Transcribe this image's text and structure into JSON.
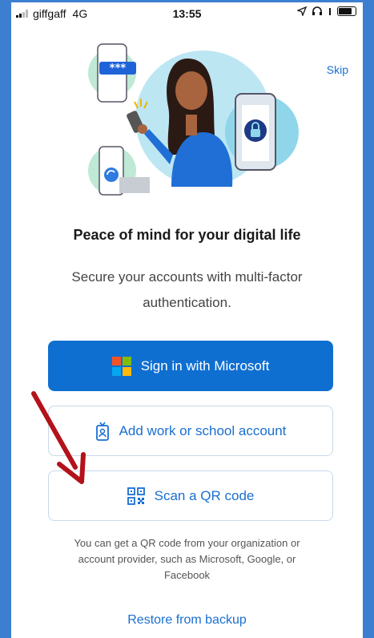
{
  "status_bar": {
    "carrier": "giffgaff",
    "network": "4G",
    "time": "13:55"
  },
  "skip_label": "Skip",
  "title": "Peace of mind for your digital life",
  "subtitle": "Secure your accounts with multi-factor authentication.",
  "password_mask": "***",
  "buttons": {
    "sign_in_microsoft": "Sign in with Microsoft",
    "add_work_school": "Add work or school account",
    "scan_qr": "Scan a QR code"
  },
  "note": "You can get a QR code from your organization or account provider, such as Microsoft, Google, or Facebook",
  "restore_link": "Restore from backup",
  "colors": {
    "frame": "#3c7fd1",
    "primary": "#0f6fd1",
    "link": "#1a6fd1",
    "annotation_arrow": "#b3121a",
    "ms_red": "#f35325",
    "ms_green": "#81bc06",
    "ms_blue": "#05a6f0",
    "ms_yellow": "#ffba08"
  },
  "icons": {
    "microsoft_logo": "microsoft-logo-icon",
    "badge": "id-badge-icon",
    "qr": "qr-code-icon"
  }
}
